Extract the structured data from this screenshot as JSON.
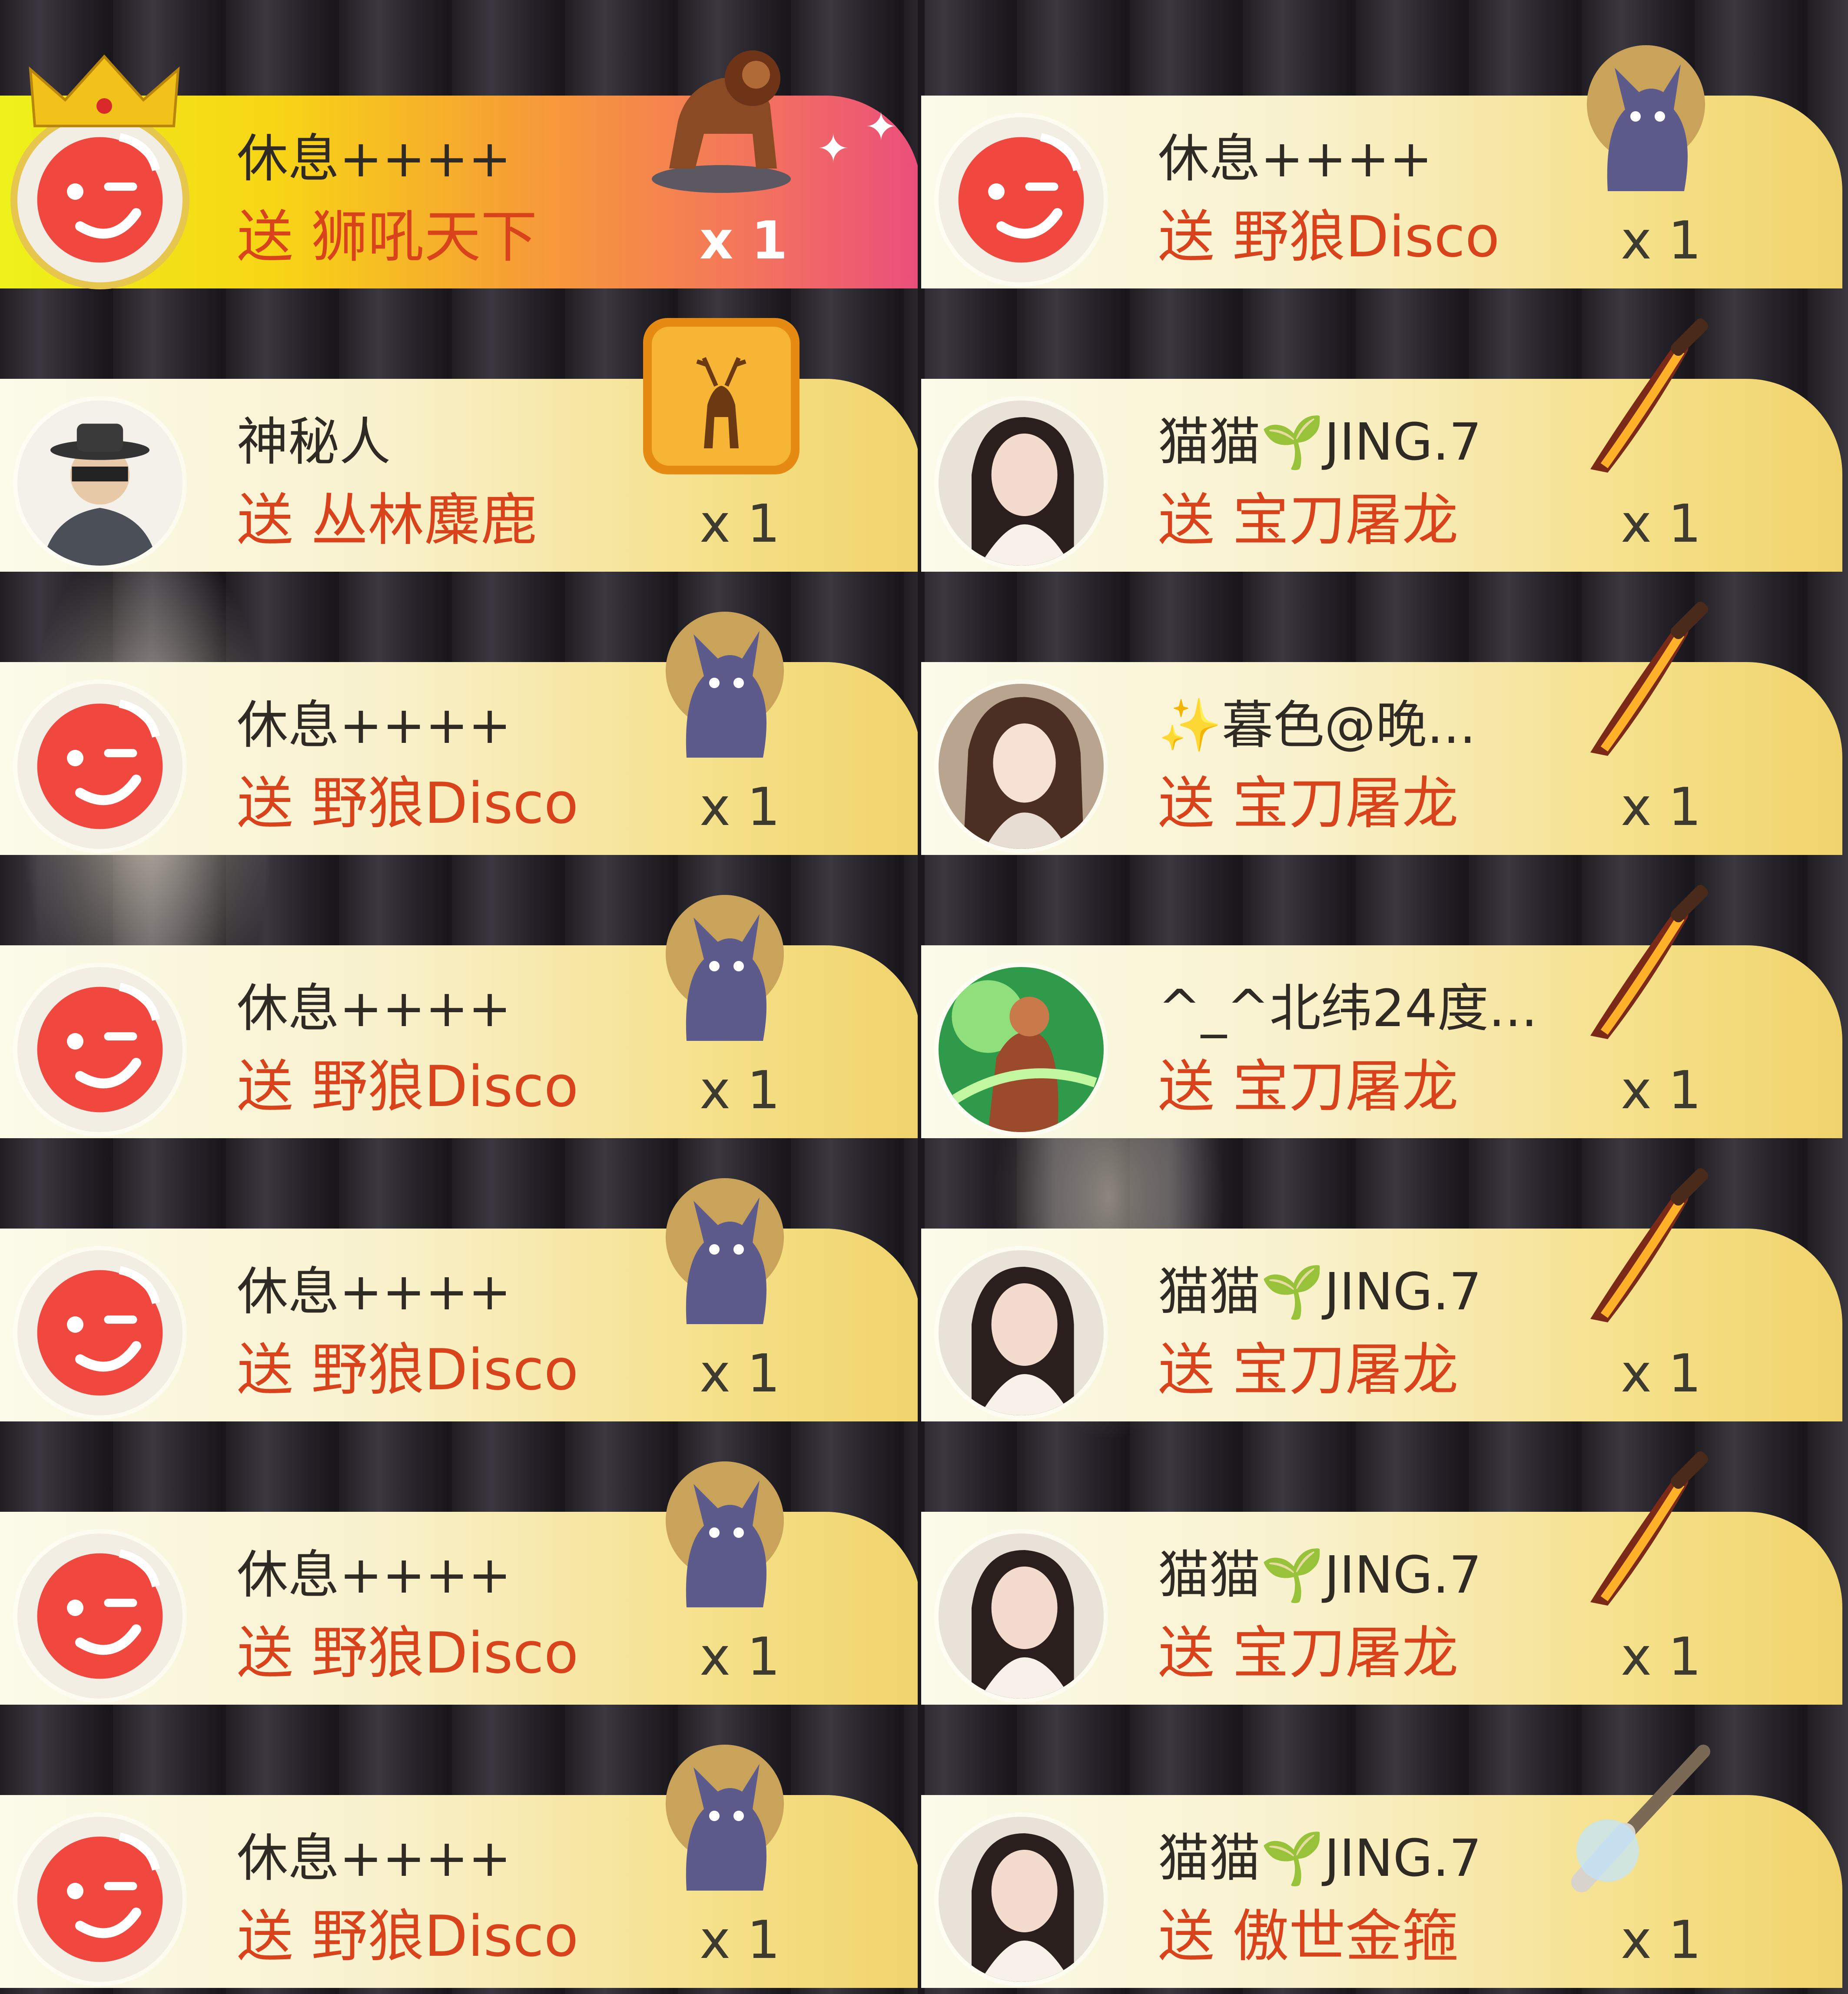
{
  "colors": {
    "gift_text": "#d8431c",
    "name_text": "#2f2a24",
    "banner_gold": "#f0d36b",
    "premium_start": "#eef21a",
    "premium_end": "#ea4e7c",
    "avatar_red": "#f0473f"
  },
  "left": [
    {
      "name": "休息++++",
      "gift": "送 狮吼天下",
      "count": "x 1",
      "gift_icon": "lion-statue-icon",
      "premium": true
    },
    {
      "name": "神秘人",
      "gift": "送 丛林麋鹿",
      "count": "x 1",
      "gift_icon": "forest-deer-icon"
    },
    {
      "name": "休息++++",
      "gift": "送 野狼Disco",
      "count": "x 1",
      "gift_icon": "wolf-disco-icon"
    },
    {
      "name": "休息++++",
      "gift": "送 野狼Disco",
      "count": "x 1",
      "gift_icon": "wolf-disco-icon"
    },
    {
      "name": "休息++++",
      "gift": "送 野狼Disco",
      "count": "x 1",
      "gift_icon": "wolf-disco-icon"
    },
    {
      "name": "休息++++",
      "gift": "送 野狼Disco",
      "count": "x 1",
      "gift_icon": "wolf-disco-icon"
    },
    {
      "name": "休息++++",
      "gift": "送 野狼Disco",
      "count": "x 1",
      "gift_icon": "wolf-disco-icon"
    }
  ],
  "right": [
    {
      "name": "休息++++",
      "gift": "送 野狼Disco",
      "count": "x 1",
      "gift_icon": "wolf-disco-icon"
    },
    {
      "name": "猫猫🌱JING.7",
      "gift": "送 宝刀屠龙",
      "count": "x 1",
      "gift_icon": "dragon-blade-icon"
    },
    {
      "name": "✨暮色@晚...",
      "gift": "送 宝刀屠龙",
      "count": "x 1",
      "gift_icon": "dragon-blade-icon"
    },
    {
      "name": "^_^北纬24度...",
      "gift": "送 宝刀屠龙",
      "count": "x 1",
      "gift_icon": "dragon-blade-icon"
    },
    {
      "name": "猫猫🌱JING.7",
      "gift": "送 宝刀屠龙",
      "count": "x 1",
      "gift_icon": "dragon-blade-icon"
    },
    {
      "name": "猫猫🌱JING.7",
      "gift": "送 宝刀屠龙",
      "count": "x 1",
      "gift_icon": "dragon-blade-icon"
    },
    {
      "name": "猫猫🌱JING.7",
      "gift": "送 傲世金箍",
      "count": "x 1",
      "gift_icon": "golden-staff-icon"
    }
  ]
}
